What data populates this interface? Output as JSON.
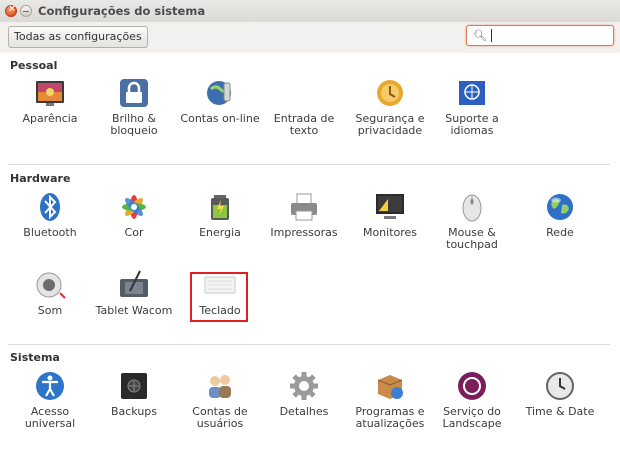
{
  "window": {
    "title": "Configurações do sistema"
  },
  "toolbar": {
    "all_settings": "Todas as configurações",
    "search_value": ""
  },
  "sections": {
    "pessoal": {
      "title": "Pessoal",
      "items": [
        {
          "label": "Aparência"
        },
        {
          "label": "Brilho & bloqueio"
        },
        {
          "label": "Contas on-line"
        },
        {
          "label": "Entrada de texto"
        },
        {
          "label": "Segurança e privacidade"
        },
        {
          "label": "Suporte a idiomas"
        }
      ]
    },
    "hardware": {
      "title": "Hardware",
      "items": [
        {
          "label": "Bluetooth"
        },
        {
          "label": "Cor"
        },
        {
          "label": "Energia"
        },
        {
          "label": "Impressoras"
        },
        {
          "label": "Monitores"
        },
        {
          "label": "Mouse & touchpad"
        },
        {
          "label": "Rede"
        },
        {
          "label": "Som"
        },
        {
          "label": "Tablet Wacom"
        },
        {
          "label": "Teclado"
        }
      ]
    },
    "sistema": {
      "title": "Sistema",
      "items": [
        {
          "label": "Acesso universal"
        },
        {
          "label": "Backups"
        },
        {
          "label": "Contas de usuários"
        },
        {
          "label": "Detalhes"
        },
        {
          "label": "Programas e atualizações"
        },
        {
          "label": "Serviço do Landscape"
        },
        {
          "label": "Time & Date"
        }
      ]
    }
  },
  "colors": {
    "accent": "#e0531d",
    "highlight_box": "#e02020"
  }
}
